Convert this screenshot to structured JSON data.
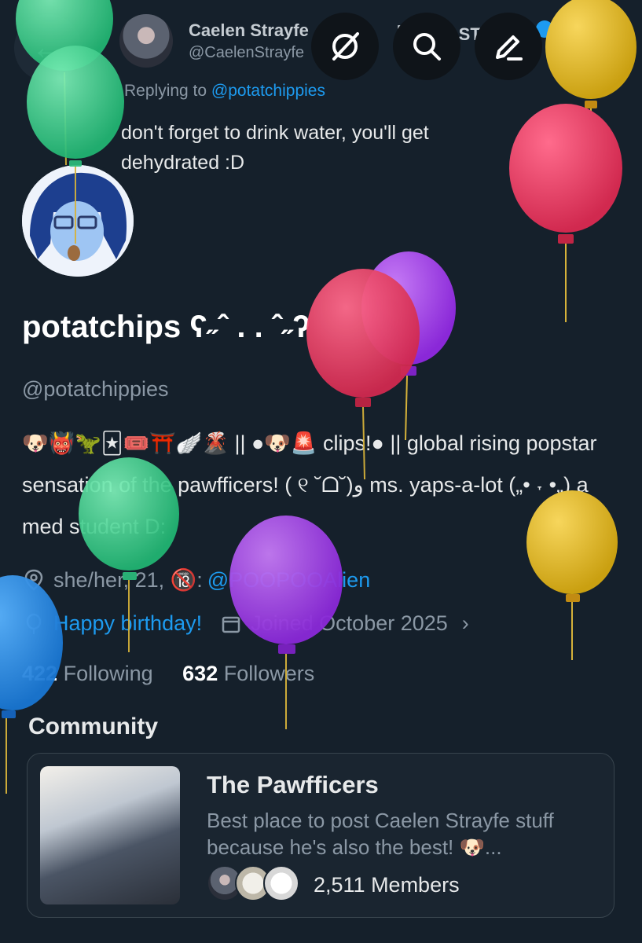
{
  "reply_header": {
    "author_name": "Caelen Strayfe",
    "author_badge": "【FIRST STAGE...",
    "author_handle": "@CaelenStrayfe",
    "replying_prefix": "Replying to",
    "replying_to": "@potatchippies",
    "text": "don't forget to drink water, you'll get dehydrated :D"
  },
  "header_icons": {
    "grok": "slashed-circle-icon",
    "search": "search-icon",
    "compose": "pencil-icon",
    "more": "more-icon"
  },
  "profile": {
    "display_name": "potatchips ʕ˶ˆ . . ˆ˶ʔ",
    "handle": "@potatchippies",
    "bio_emojis": "🐶👹🦖🃏🎟️⛩️🪽🌋",
    "bio": "|| ●🐶🚨 clips!● || global rising popstar sensation of the pawfficers! ( ୧ ˘ᗝ˘)و ms. yaps-a-lot („• ˕ •„) a med student D:",
    "location": "she/her, 21, 🔞:",
    "location_link": "@POOPOOAlien",
    "birthday": "Happy birthday!",
    "joined": "Joined October 2025",
    "following_count": "422",
    "following_label": "Following",
    "followers_count": "632",
    "followers_label": "Followers"
  },
  "community": {
    "section_label": "Community",
    "name": "The Pawfficers",
    "description": "Best place to post Caelen Strayfe stuff because he's also the best! 🐶...",
    "members": "2,511 Members"
  },
  "colors": {
    "background": "#15202b",
    "accent": "#1d9bf0",
    "balloon_green": "#3ed68f",
    "balloon_yellow": "#e5b72a",
    "balloon_red": "#e83c63",
    "balloon_purple": "#9b3fe0",
    "balloon_blue": "#1e88e5"
  }
}
